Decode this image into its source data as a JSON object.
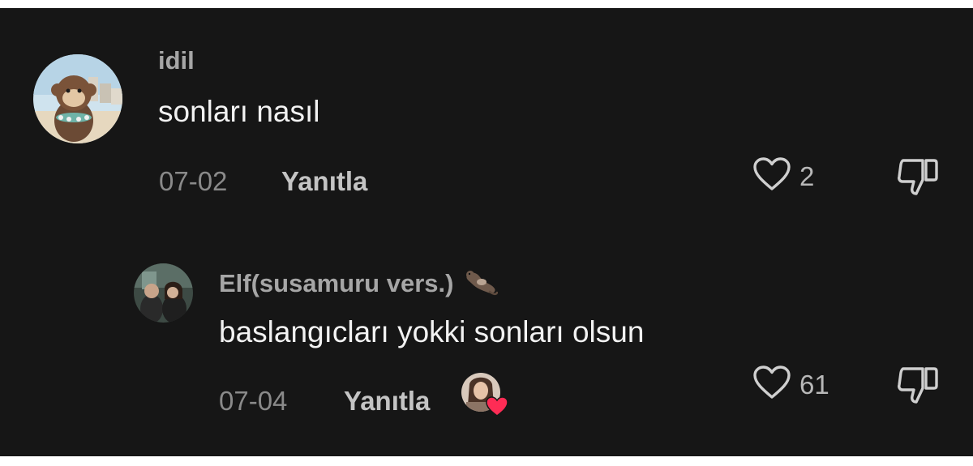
{
  "comments": [
    {
      "username": "idil",
      "text": "sonları nasıl",
      "date": "07-02",
      "reply_label": "Yanıtla",
      "likes": "2"
    },
    {
      "username": "Elf(susamuru vers.)",
      "text": "baslangıcları yokki sonları olsun",
      "date": "07-04",
      "reply_label": "Yanıtla",
      "likes": "61"
    }
  ],
  "icons": {
    "like": "heart-outline-icon",
    "dislike": "thumbs-down-outline-icon",
    "username_badge": "otter-emoji",
    "creator_liked_badge": "heart-icon"
  },
  "colors": {
    "background": "#161616",
    "comment_text": "#f2f2f2",
    "username": "#a6a6a6",
    "meta": "#8a8a8a",
    "creator_heart": "#fe2c55"
  }
}
